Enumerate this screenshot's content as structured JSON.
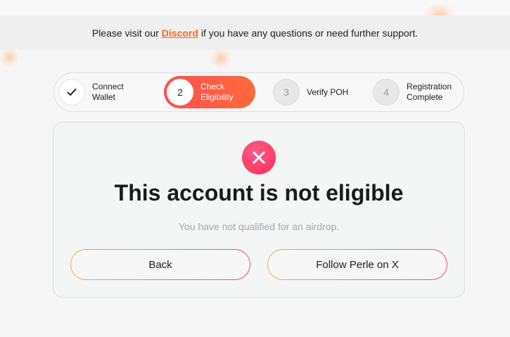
{
  "banner": {
    "prefix": "Please visit our",
    "link": "Discord",
    "suffix": "if you have any questions or need further support."
  },
  "steps": [
    {
      "number": "✓",
      "label": "Connect Wallet",
      "state": "done"
    },
    {
      "number": "2",
      "label": "Check Eligibility",
      "state": "active"
    },
    {
      "number": "3",
      "label": "Verify POH",
      "state": "pending"
    },
    {
      "number": "4",
      "label": "Registration Complete",
      "state": "pending"
    }
  ],
  "result": {
    "icon": "close-icon",
    "title": "This account is not eligible",
    "message": "You have not qualified for an airdrop."
  },
  "buttons": {
    "back": "Back",
    "follow": "Follow Perle on X"
  },
  "colors": {
    "link": "#f26b1d",
    "active_step_start": "#ff4d52",
    "active_step_end": "#ff6a3a",
    "error": "#ff3f6a",
    "button_border_start": "#f0b33a",
    "button_border_end": "#e94a8c"
  }
}
